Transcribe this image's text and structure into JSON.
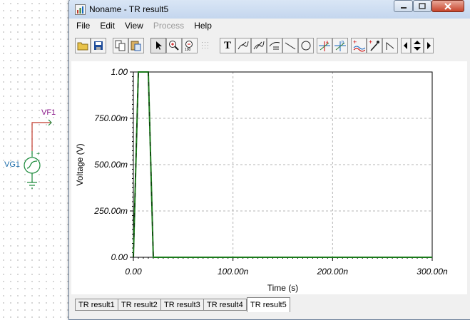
{
  "schematic": {
    "probe_label": "VF1",
    "source_label": "VG1",
    "wire_color": "#c0392b",
    "component_color": "#1a8a3a"
  },
  "window": {
    "title": "Noname - TR result5",
    "controls": {
      "minimize": "minimize-icon",
      "maximize": "maximize-icon",
      "close": "close-icon"
    }
  },
  "menu": [
    {
      "label": "File",
      "enabled": true
    },
    {
      "label": "Edit",
      "enabled": true
    },
    {
      "label": "View",
      "enabled": true
    },
    {
      "label": "Process",
      "enabled": false
    },
    {
      "label": "Help",
      "enabled": true
    }
  ],
  "toolbar": {
    "buttons": [
      "open-folder-icon",
      "save-icon",
      "copy-icon",
      "paste-icon",
      "pointer-icon",
      "zoom-in-icon",
      "zoom-100-icon",
      "grid-icon",
      "text-icon",
      "annotate-icon",
      "annotate-2-icon",
      "annotate-3-icon",
      "line-icon",
      "circle-icon",
      "cursor-a-icon",
      "cursor-b-icon",
      "add-curve-icon",
      "probe-icon",
      "corner-icon",
      "arrow-left-icon",
      "arrow-updown-icon",
      "arrow-right-icon"
    ],
    "text_glyph": "T"
  },
  "chart_data": {
    "type": "line",
    "title": "",
    "xlabel": "Time (s)",
    "ylabel": "Voltage (V)",
    "xlim": [
      0,
      300
    ],
    "ylim": [
      0,
      1
    ],
    "x_unit": "ns",
    "x_ticks": [
      "0.00",
      "100.00n",
      "200.00n",
      "300.00n"
    ],
    "y_ticks": [
      "0.00",
      "250.00m",
      "500.00m",
      "750.00m",
      "1.00"
    ],
    "grid": true,
    "series": [
      {
        "color": "#1a7a1a",
        "x": [
          0,
          5,
          15,
          20,
          300
        ],
        "y": [
          0,
          1,
          1,
          0,
          0
        ]
      }
    ]
  },
  "tabs": [
    {
      "label": "TR result1",
      "active": false
    },
    {
      "label": "TR result2",
      "active": false
    },
    {
      "label": "TR result3",
      "active": false
    },
    {
      "label": "TR result4",
      "active": false
    },
    {
      "label": "TR result5",
      "active": true
    }
  ]
}
